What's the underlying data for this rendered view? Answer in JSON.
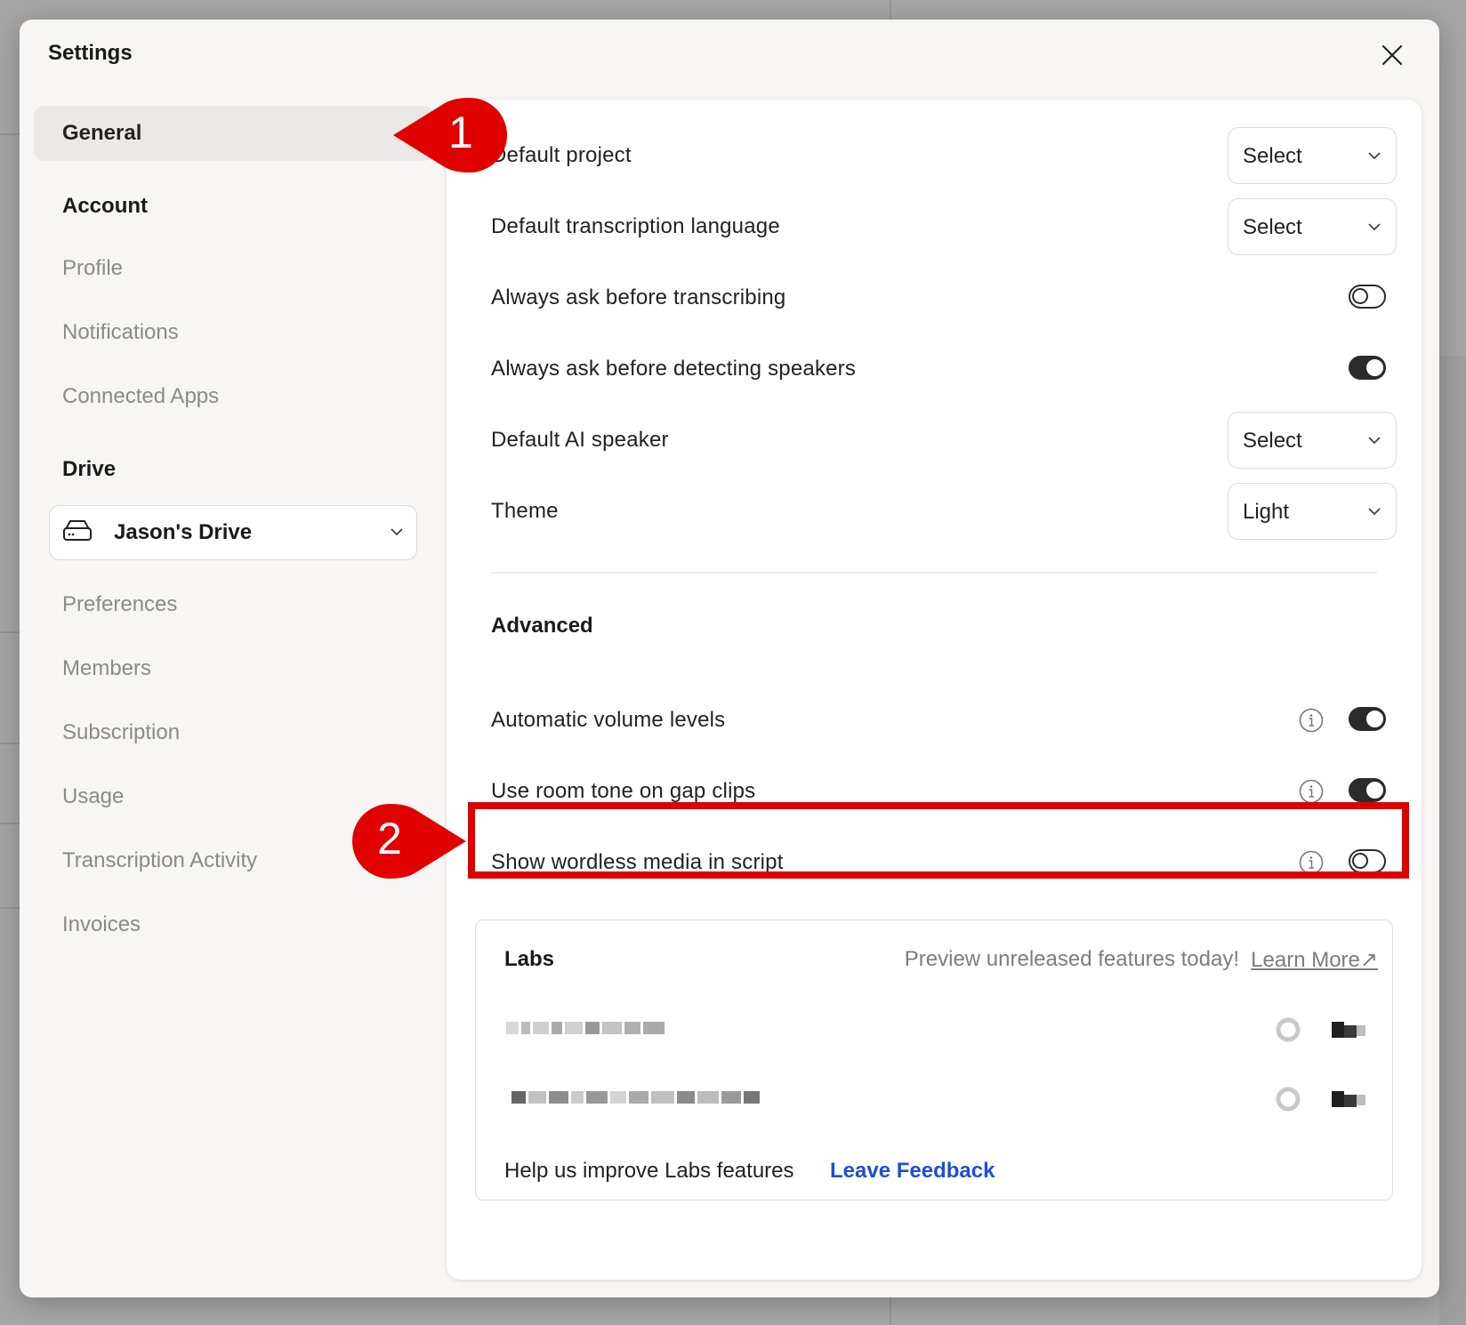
{
  "modal": {
    "title": "Settings"
  },
  "sidebar": {
    "general": "General",
    "account_heading": "Account",
    "account_items": [
      "Profile",
      "Notifications",
      "Connected Apps"
    ],
    "drive_heading": "Drive",
    "drive_select": "Jason's Drive",
    "drive_items": [
      "Preferences",
      "Members",
      "Subscription",
      "Usage",
      "Transcription Activity",
      "Invoices"
    ]
  },
  "general": {
    "default_project": {
      "label": "Default project",
      "value": "Select"
    },
    "default_language": {
      "label": "Default transcription language",
      "value": "Select"
    },
    "ask_transcribing": {
      "label": "Always ask before transcribing",
      "on": false
    },
    "ask_speakers": {
      "label": "Always ask before detecting speakers",
      "on": true
    },
    "default_ai_speaker": {
      "label": "Default AI speaker",
      "value": "Select"
    },
    "theme": {
      "label": "Theme",
      "value": "Light"
    }
  },
  "advanced": {
    "heading": "Advanced",
    "auto_volume": {
      "label": "Automatic volume levels",
      "on": true
    },
    "room_tone": {
      "label": "Use room tone on gap clips",
      "on": true
    },
    "wordless_media": {
      "label": "Show wordless media in script",
      "on": false
    }
  },
  "labs": {
    "title": "Labs",
    "preview": "Preview unreleased features today!",
    "learn_more": "Learn More↗",
    "help": "Help us improve Labs features",
    "feedback": "Leave Feedback"
  },
  "callouts": [
    "1",
    "2"
  ],
  "colors": {
    "accent_red": "#e00000",
    "link_blue": "#1d4ed8",
    "toggle_dark": "#2b2b2b"
  }
}
